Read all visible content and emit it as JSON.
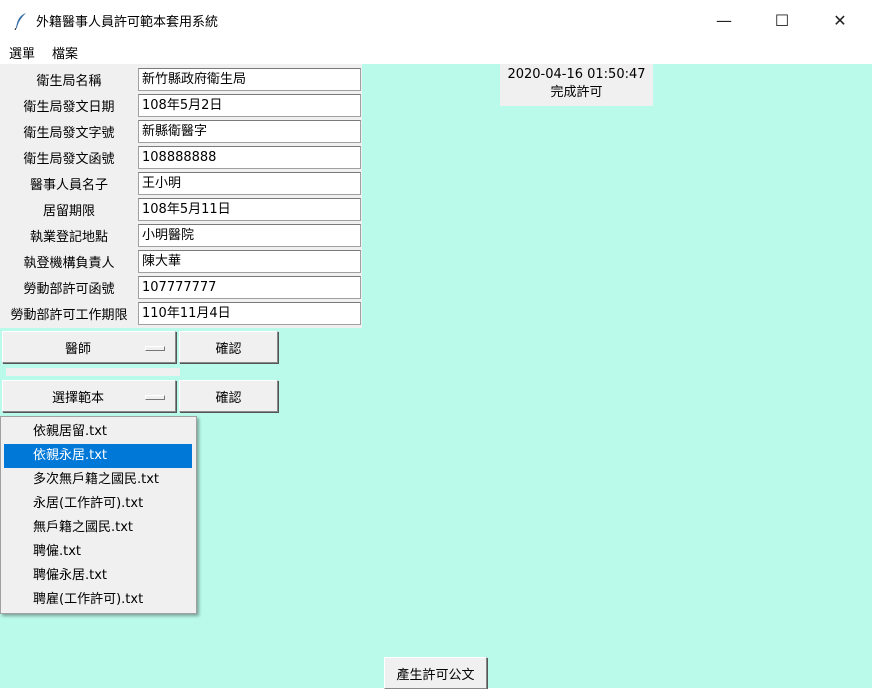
{
  "window": {
    "title": "外籍醫事人員許可範本套用系統",
    "minimize_glyph": "—",
    "maximize_glyph": "☐",
    "close_glyph": "✕"
  },
  "menu": {
    "items": [
      {
        "label": "選單"
      },
      {
        "label": "檔案"
      }
    ]
  },
  "form": {
    "fields": [
      {
        "label": "衛生局名稱",
        "value": "新竹縣政府衛生局"
      },
      {
        "label": "衛生局發文日期",
        "value": "108年5月2日"
      },
      {
        "label": "衛生局發文字號",
        "value": "新縣衛醫字"
      },
      {
        "label": "衛生局發文函號",
        "value": "108888888"
      },
      {
        "label": "醫事人員名子",
        "value": "王小明"
      },
      {
        "label": "居留期限",
        "value": "108年5月11日"
      },
      {
        "label": "執業登記地點",
        "value": "小明醫院"
      },
      {
        "label": "執登機構負責人",
        "value": "陳大華"
      },
      {
        "label": "勞動部許可函號",
        "value": "107777777"
      },
      {
        "label": "勞動部許可工作期限",
        "value": "110年11月4日"
      }
    ]
  },
  "profession_select": {
    "selected": "醫師",
    "confirm_label": "確認"
  },
  "template_select": {
    "selected": "選擇範本",
    "confirm_label": "確認",
    "options": [
      {
        "label": "依親居留.txt"
      },
      {
        "label": "依親永居.txt"
      },
      {
        "label": "多次無戶籍之國民.txt"
      },
      {
        "label": "永居(工作許可).txt"
      },
      {
        "label": "無戶籍之國民.txt"
      },
      {
        "label": "聘僱.txt"
      },
      {
        "label": "聘僱永居.txt"
      },
      {
        "label": "聘雇(工作許可).txt"
      }
    ],
    "highlighted_index": 1
  },
  "status": {
    "timestamp": "2020-04-16 01:50:47",
    "message": "完成許可"
  },
  "generate_button": {
    "label": "產生許可公文"
  },
  "colors": {
    "client_background": "#bafaea",
    "widget_background": "#f0f0f0",
    "selection": "#0078d7"
  },
  "icons": {
    "app": "feather-icon"
  }
}
